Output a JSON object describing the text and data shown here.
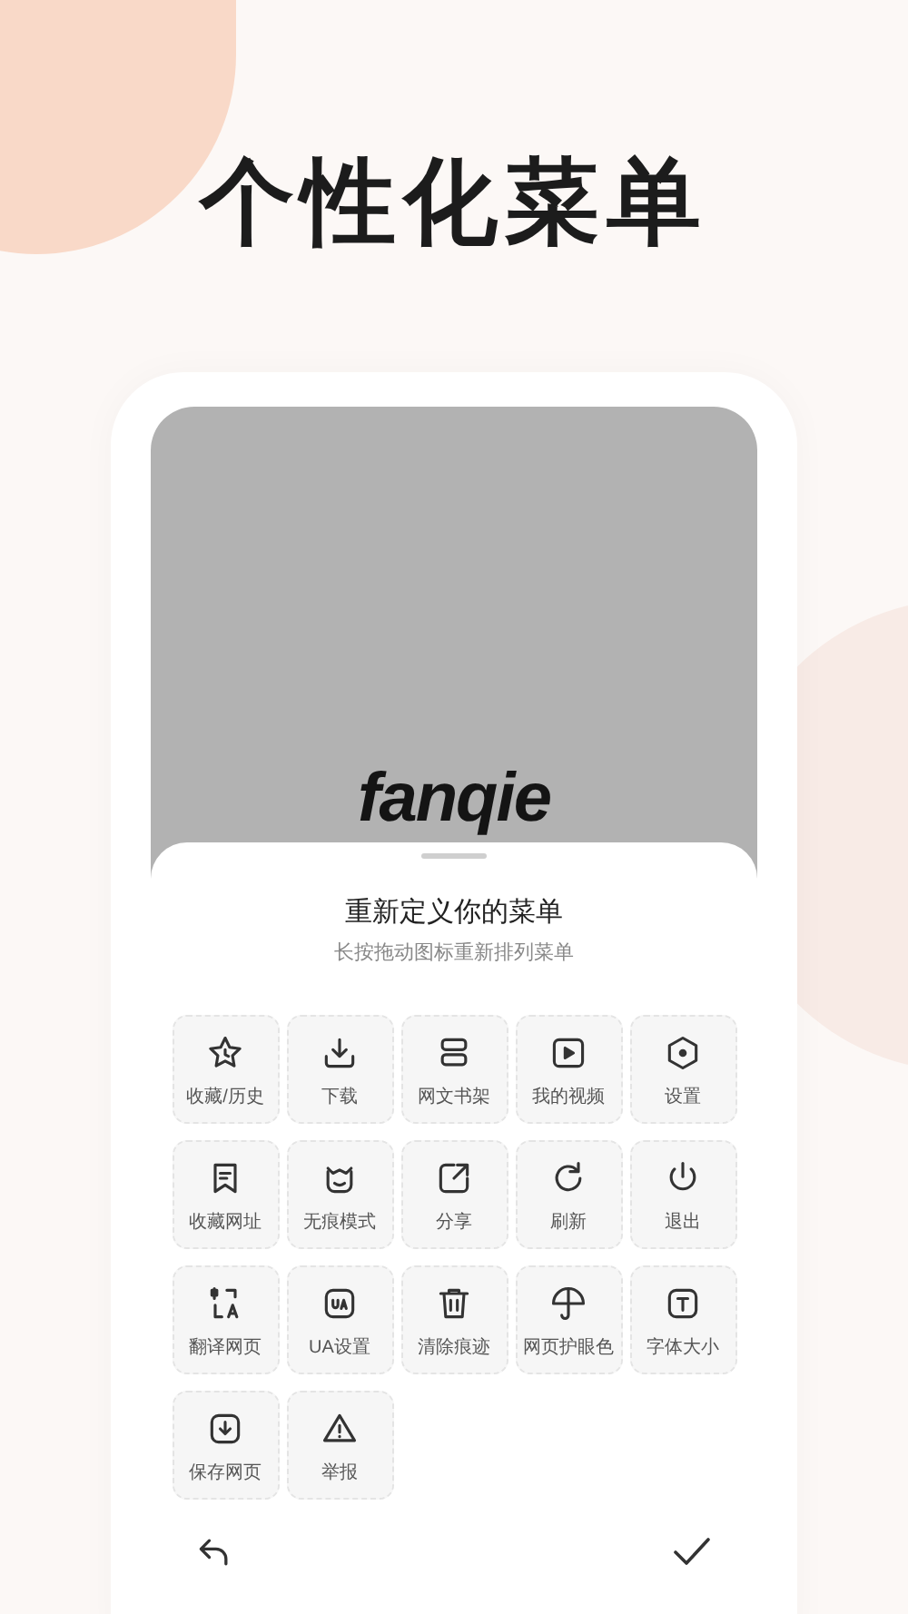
{
  "headline": "个性化菜单",
  "logo": "fanqie",
  "sheet": {
    "title": "重新定义你的菜单",
    "subtitle": "长按拖动图标重新排列菜单"
  },
  "menu_items": [
    {
      "label": "收藏/历史"
    },
    {
      "label": "下载"
    },
    {
      "label": "网文书架"
    },
    {
      "label": "我的视频"
    },
    {
      "label": "设置"
    },
    {
      "label": "收藏网址"
    },
    {
      "label": "无痕模式"
    },
    {
      "label": "分享"
    },
    {
      "label": "刷新"
    },
    {
      "label": "退出"
    },
    {
      "label": "翻译网页"
    },
    {
      "label": "UA设置"
    },
    {
      "label": "清除痕迹"
    },
    {
      "label": "网页护眼色"
    },
    {
      "label": "字体大小"
    },
    {
      "label": "保存网页"
    },
    {
      "label": "举报"
    }
  ]
}
